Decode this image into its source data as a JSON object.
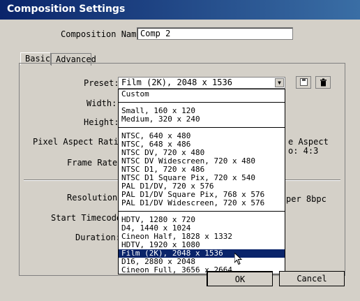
{
  "window": {
    "title": "Composition Settings"
  },
  "comp_name": {
    "label": "Composition Name:",
    "value": "Comp 2"
  },
  "tabs": [
    {
      "label": "Basic"
    },
    {
      "label": "Advanced"
    }
  ],
  "fields": {
    "preset": "Preset:",
    "width": "Width:",
    "height": "Height:",
    "pixel_aspect": "Pixel Aspect Ratio:",
    "frame_rate": "Frame Rate:",
    "resolution": "Resolution:",
    "start_timecode": "Start Timecode:",
    "duration": "Duration:"
  },
  "right_side": {
    "aspect_a": "e Aspect",
    "aspect_b": "o: 4:3",
    "depth": "per 8bpc"
  },
  "preset": {
    "value": "Film (2K), 2048 x 1536",
    "options": [
      "Custom",
      "Small, 160 x 120",
      "Medium, 320 x 240",
      "NTSC, 640 x 480",
      "NTSC, 648 x 486",
      "NTSC DV, 720 x 480",
      "NTSC DV Widescreen, 720 x 480",
      "NTSC D1, 720 x 486",
      "NTSC D1 Square Pix, 720 x 540",
      "PAL D1/DV, 720 x 576",
      "PAL D1/DV Square Pix, 768 x 576",
      "PAL D1/DV Widescreen, 720 x 576",
      "HDTV, 1280 x 720",
      "D4, 1440 x 1024",
      "Cineon Half, 1828 x 1332",
      "HDTV, 1920 x 1080",
      "Film (2K), 2048 x 1536",
      "D16, 2880 x 2048",
      "Cineon Full, 3656 x 2664"
    ],
    "selected_option": "Film (2K), 2048 x 1536"
  },
  "buttons": {
    "ok": "OK",
    "cancel": "Cancel"
  },
  "icons": {
    "save": "save-icon",
    "delete": "trash-icon"
  }
}
